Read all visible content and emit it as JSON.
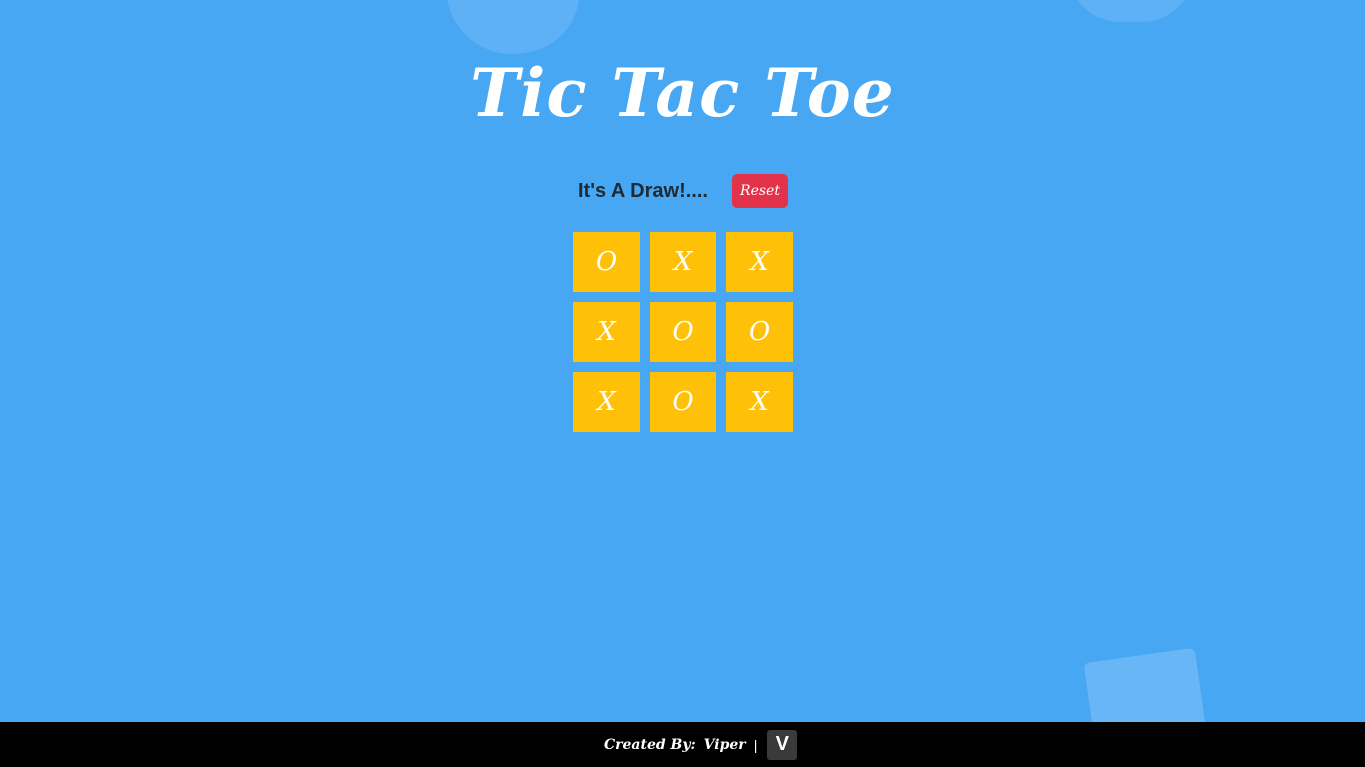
{
  "title": "Tic Tac Toe",
  "status": {
    "message": "It's A Draw!....",
    "reset_label": "Reset"
  },
  "board": {
    "cells": [
      "O",
      "X",
      "X",
      "X",
      "O",
      "O",
      "X",
      "O",
      "X"
    ]
  },
  "footer": {
    "created_by_label": "Created By:",
    "author": "Viper",
    "separator": "|",
    "logo_letter": "V"
  },
  "colors": {
    "background": "#47a7f3",
    "cell": "#ffc107",
    "reset": "#e3334a",
    "footer": "#000000"
  }
}
